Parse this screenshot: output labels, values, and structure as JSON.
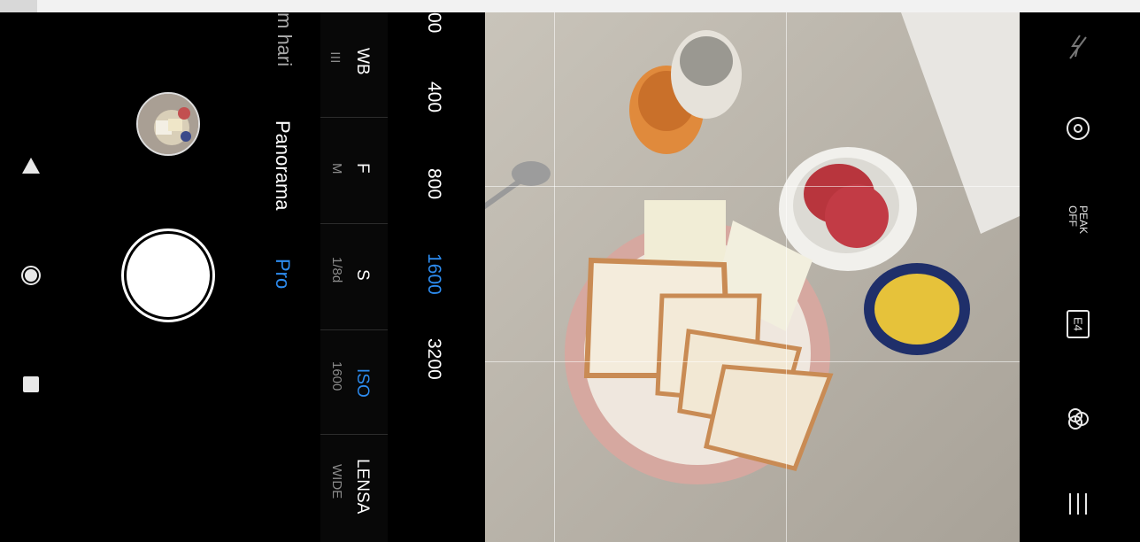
{
  "nav": {
    "back_icon": "triangle-back-icon",
    "home_icon": "circle-home-icon",
    "recents_icon": "square-recents-icon"
  },
  "camera": {
    "modes": [
      "m hari",
      "Panorama",
      "Pro"
    ],
    "selected_mode": "Pro"
  },
  "pro_panel": {
    "wb": {
      "label": "WB"
    },
    "f": {
      "label": "F",
      "value": "M"
    },
    "s": {
      "label": "S",
      "value": "1/8d"
    },
    "iso": {
      "label": "ISO",
      "value": "1600"
    },
    "lens": {
      "label": "LENSA",
      "value": "WIDE"
    }
  },
  "iso_values": [
    "00",
    "400",
    "800",
    "1600",
    "3200"
  ],
  "iso_selected": "1600",
  "right_bar": {
    "flash_icon": "flash-off-icon",
    "lens_icon": "lens-switch-icon",
    "peak_label": "PEAK OFF",
    "ratio_label": "E4",
    "filter_icon": "color-filter-icon",
    "menu_icon": "menu-lines-icon"
  },
  "colors": {
    "accent": "#2d8cf0"
  }
}
